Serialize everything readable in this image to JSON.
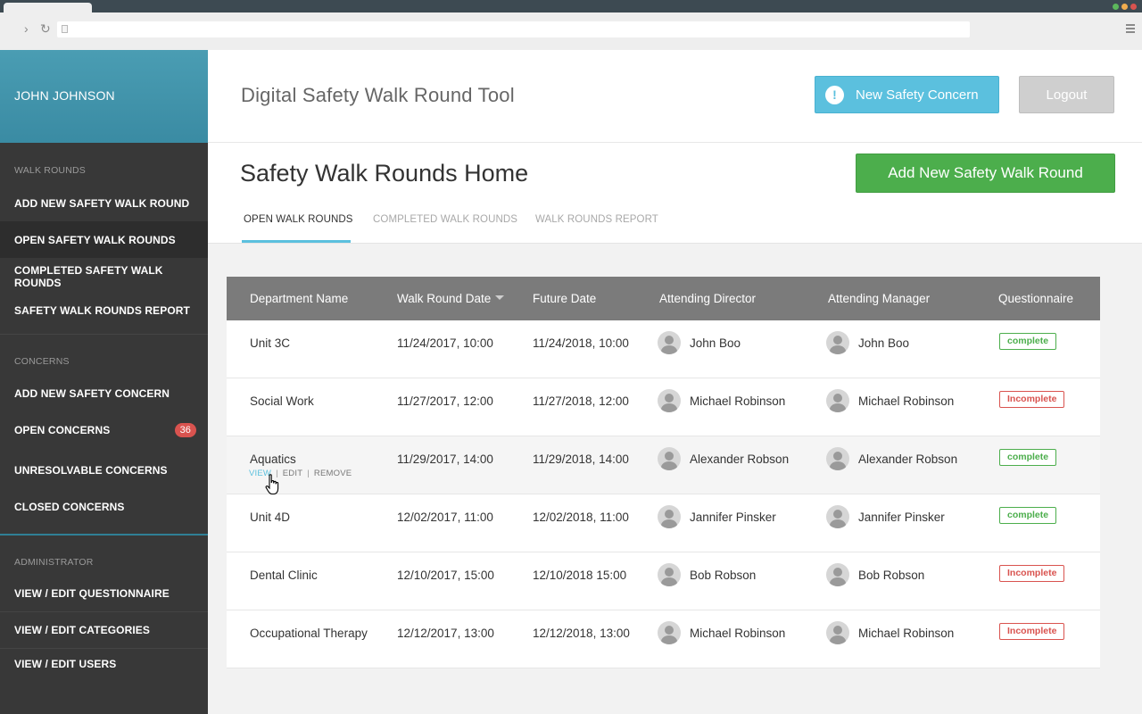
{
  "sidebar": {
    "user_name": "JOHN JOHNSON",
    "walk_rounds_title": "WALK ROUNDS",
    "walk_rounds_items": [
      {
        "label": "ADD NEW SAFETY WALK ROUND"
      },
      {
        "label": "OPEN SAFETY WALK ROUNDS"
      },
      {
        "label": "COMPLETED SAFETY WALK ROUNDS"
      },
      {
        "label": "SAFETY WALK ROUNDS REPORT"
      }
    ],
    "concerns_title": "CONCERNS",
    "concerns_items": [
      {
        "label": "ADD NEW SAFETY CONCERN"
      },
      {
        "label": "OPEN CONCERNS",
        "badge": "36"
      },
      {
        "label": "UNRESOLVABLE CONCERNS"
      },
      {
        "label": "CLOSED CONCERNS"
      }
    ],
    "admin_title": "ADMINISTRATOR",
    "admin_items": [
      {
        "label": "VIEW / EDIT QUESTIONNAIRE"
      },
      {
        "label": "VIEW / EDIT  CATEGORIES"
      },
      {
        "label": "VIEW / EDIT USERS"
      }
    ]
  },
  "header": {
    "app_title": "Digital Safety Walk Round Tool",
    "new_concern_label": "New Safety Concern",
    "logout_label": "Logout"
  },
  "subheader": {
    "page_title": "Safety Walk Rounds Home",
    "add_button_label": "Add New Safety Walk Round",
    "tabs": [
      {
        "label": "OPEN WALK ROUNDS"
      },
      {
        "label": "COMPLETED WALK ROUNDS"
      },
      {
        "label": "WALK ROUNDS REPORT"
      }
    ]
  },
  "table": {
    "columns": [
      "Department Name",
      "Walk Round Date",
      "Future Date",
      "Attending Director",
      "Attending Manager",
      "Questionnaire"
    ],
    "row_actions": {
      "view": "VIEW",
      "edit": "EDIT",
      "remove": "REMOVE"
    },
    "rows": [
      {
        "department": "Unit 3C",
        "walk_date": "11/24/2017, 10:00",
        "future_date": "11/24/2018, 10:00",
        "director": "John Boo",
        "manager": "John Boo",
        "status": "complete"
      },
      {
        "department": "Social Work",
        "walk_date": "11/27/2017, 12:00",
        "future_date": "11/27/2018, 12:00",
        "director": "Michael Robinson",
        "manager": "Michael Robinson",
        "status": "Incomplete"
      },
      {
        "department": "Aquatics",
        "walk_date": "11/29/2017, 14:00",
        "future_date": "11/29/2018, 14:00",
        "director": "Alexander Robson",
        "manager": "Alexander Robson",
        "status": "complete"
      },
      {
        "department": "Unit 4D",
        "walk_date": "12/02/2017, 11:00",
        "future_date": "12/02/2018, 11:00",
        "director": "Jannifer Pinsker",
        "manager": "Jannifer Pinsker",
        "status": "complete"
      },
      {
        "department": "Dental Clinic",
        "walk_date": "12/10/2017, 15:00",
        "future_date": "12/10/2018 15:00",
        "director": "Bob Robson",
        "manager": "Bob Robson",
        "status": "Incomplete"
      },
      {
        "department": "Occupational Therapy",
        "walk_date": "12/12/2017, 13:00",
        "future_date": "12/12/2018, 13:00",
        "director": "Michael Robinson",
        "manager": "Michael Robinson",
        "status": "Incomplete"
      }
    ]
  },
  "colors": {
    "accent": "#5bc0de",
    "success": "#4cae4c",
    "danger": "#d9534f",
    "sidebar_bg": "#383838"
  }
}
